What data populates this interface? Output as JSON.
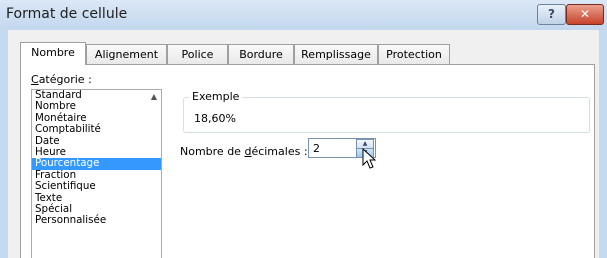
{
  "window": {
    "title": "Format de cellule",
    "help_label": "?",
    "close_label": "✕"
  },
  "tabs": [
    {
      "label": "Nombre",
      "active": true
    },
    {
      "label": "Alignement",
      "active": false
    },
    {
      "label": "Police",
      "active": false
    },
    {
      "label": "Bordure",
      "active": false
    },
    {
      "label": "Remplissage",
      "active": false
    },
    {
      "label": "Protection",
      "active": false
    }
  ],
  "category": {
    "label_prefix": "C",
    "label_rest": "atégorie :",
    "items": [
      "Standard",
      "Nombre",
      "Monétaire",
      "Comptabilité",
      "Date",
      "Heure",
      "Pourcentage",
      "Fraction",
      "Scientifique",
      "Texte",
      "Spécial",
      "Personnalisée"
    ],
    "selected": "Pourcentage"
  },
  "sample": {
    "legend": "Exemple",
    "value": "18,60%"
  },
  "decimals": {
    "label_before": "Nombre de ",
    "label_accel": "d",
    "label_after": "écimales :",
    "value": "2"
  },
  "icons": {
    "help": "help-icon",
    "close": "close-icon",
    "spin_up": "spin-up-arrow-icon",
    "spin_down": "spin-down-arrow-icon",
    "cursor": "mouse-pointer-icon"
  }
}
